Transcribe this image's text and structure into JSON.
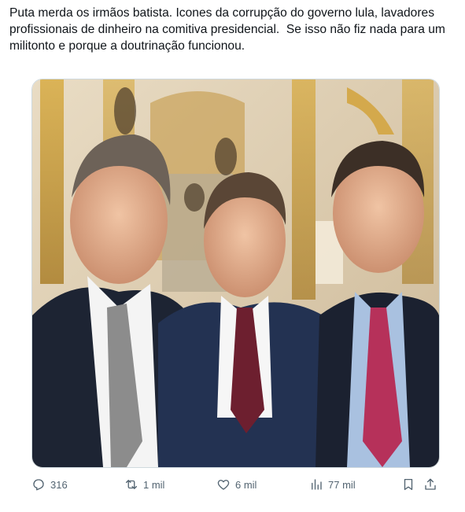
{
  "tweet": {
    "text": "Puta merda os irmãos batista. Icones da corrupção do governo lula, lavadores profissionais de dinheiro na comitiva presidencial.  Se isso não fiz nada para um militonto e porque a doutrinação funcionou."
  },
  "media": {
    "description_icon": "photo"
  },
  "actions": {
    "reply_count": "316",
    "retweet_count": "1 mil",
    "like_count": "6 mil",
    "views_count": "77 mil"
  },
  "colors": {
    "text": "#0f1419",
    "muted": "#536471",
    "border": "#cfd9de"
  }
}
